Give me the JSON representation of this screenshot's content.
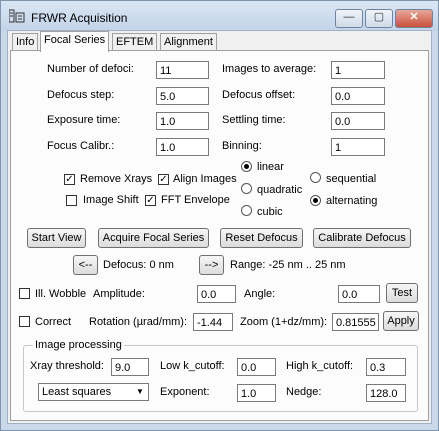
{
  "window": {
    "title": "FRWR Acquisition",
    "minimize": "—",
    "maximize": "▢",
    "close": "✕"
  },
  "tabs": [
    "Info",
    "Focal Series",
    "EFTEM",
    "Alignment"
  ],
  "params": {
    "num_defoci_label": "Number of defoci:",
    "num_defoci": "11",
    "images_avg_label": "Images to average:",
    "images_avg": "1",
    "defocus_step_label": "Defocus step:",
    "defocus_step": "5.0",
    "defocus_offset_label": "Defocus offset:",
    "defocus_offset": "0.0",
    "exposure_label": "Exposure time:",
    "exposure": "1.0",
    "settling_label": "Settling time:",
    "settling": "0.0",
    "focus_calibr_label": "Focus Calibr.:",
    "focus_calibr": "1.0",
    "binning_label": "Binning:",
    "binning": "1"
  },
  "options": {
    "remove_xrays": "Remove Xrays",
    "align_images": "Align Images",
    "image_shift": "Image Shift",
    "fft_envelope": "FFT Envelope",
    "linear": "linear",
    "quadratic": "quadratic",
    "cubic": "cubic",
    "sequential": "sequential",
    "alternating": "alternating"
  },
  "buttons": {
    "start_view": "Start View",
    "acquire": "Acquire Focal Series",
    "reset_defocus": "Reset Defocus",
    "calibrate_defocus": "Calibrate Defocus",
    "prev": "<--",
    "next": "-->",
    "test": "Test",
    "apply": "Apply"
  },
  "defocus": {
    "readout": "Defocus:  0 nm",
    "range": "Range: -25 nm .. 25 nm"
  },
  "wobble": {
    "label": "Ill. Wobble",
    "amplitude_label": "Amplitude:",
    "amplitude": "0.0",
    "angle_label": "Angle:",
    "angle": "0.0"
  },
  "correct": {
    "label": "Correct",
    "rotation_label": "Rotation (µrad/mm):",
    "rotation": "-1.44",
    "zoom_label": "Zoom (1+dz/mm):",
    "zoom": "0.81555"
  },
  "processing": {
    "title": "Image processing",
    "xray_label": "Xray threshold:",
    "xray": "9.0",
    "low_k_label": "Low k_cutoff:",
    "low_k": "0.0",
    "high_k_label": "High k_cutoff:",
    "high_k": "0.3",
    "method": "Least squares",
    "exponent_label": "Exponent:",
    "exponent": "1.0",
    "nedge_label": "Nedge:",
    "nedge": "128.0"
  }
}
